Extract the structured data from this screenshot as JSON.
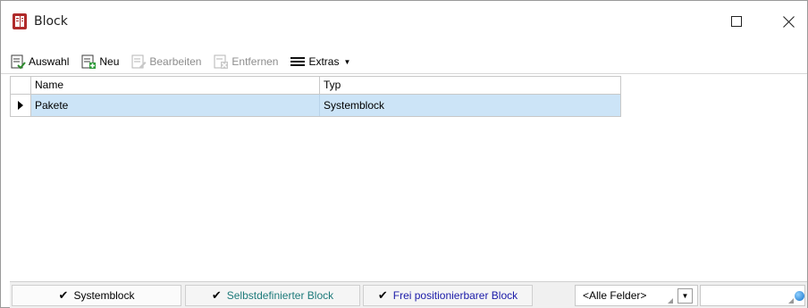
{
  "window": {
    "title": "Block"
  },
  "toolbar": {
    "items": [
      {
        "label": "Auswahl",
        "icon": "select-icon",
        "enabled": true
      },
      {
        "label": "Neu",
        "icon": "new-icon",
        "enabled": true
      },
      {
        "label": "Bearbeiten",
        "icon": "edit-icon",
        "enabled": false
      },
      {
        "label": "Entfernen",
        "icon": "remove-icon",
        "enabled": false
      },
      {
        "label": "Extras",
        "icon": "menu-icon",
        "enabled": true
      }
    ]
  },
  "grid": {
    "columns": [
      "Name",
      "Typ"
    ],
    "rows": [
      {
        "name": "Pakete",
        "typ": "Systemblock",
        "selected": true
      }
    ]
  },
  "filters": {
    "buttons": [
      {
        "label": "Systemblock",
        "checked": true
      },
      {
        "label": "Selbstdefinierter Block",
        "checked": true
      },
      {
        "label": "Frei positionierbarer Block",
        "checked": true
      }
    ],
    "field_select": {
      "value": "<Alle Felder>"
    },
    "search": {
      "value": ""
    }
  },
  "colors": {
    "selection": "#cce4f7",
    "filter_custom": "#1d7a7a",
    "filter_free": "#1a1aa8"
  }
}
